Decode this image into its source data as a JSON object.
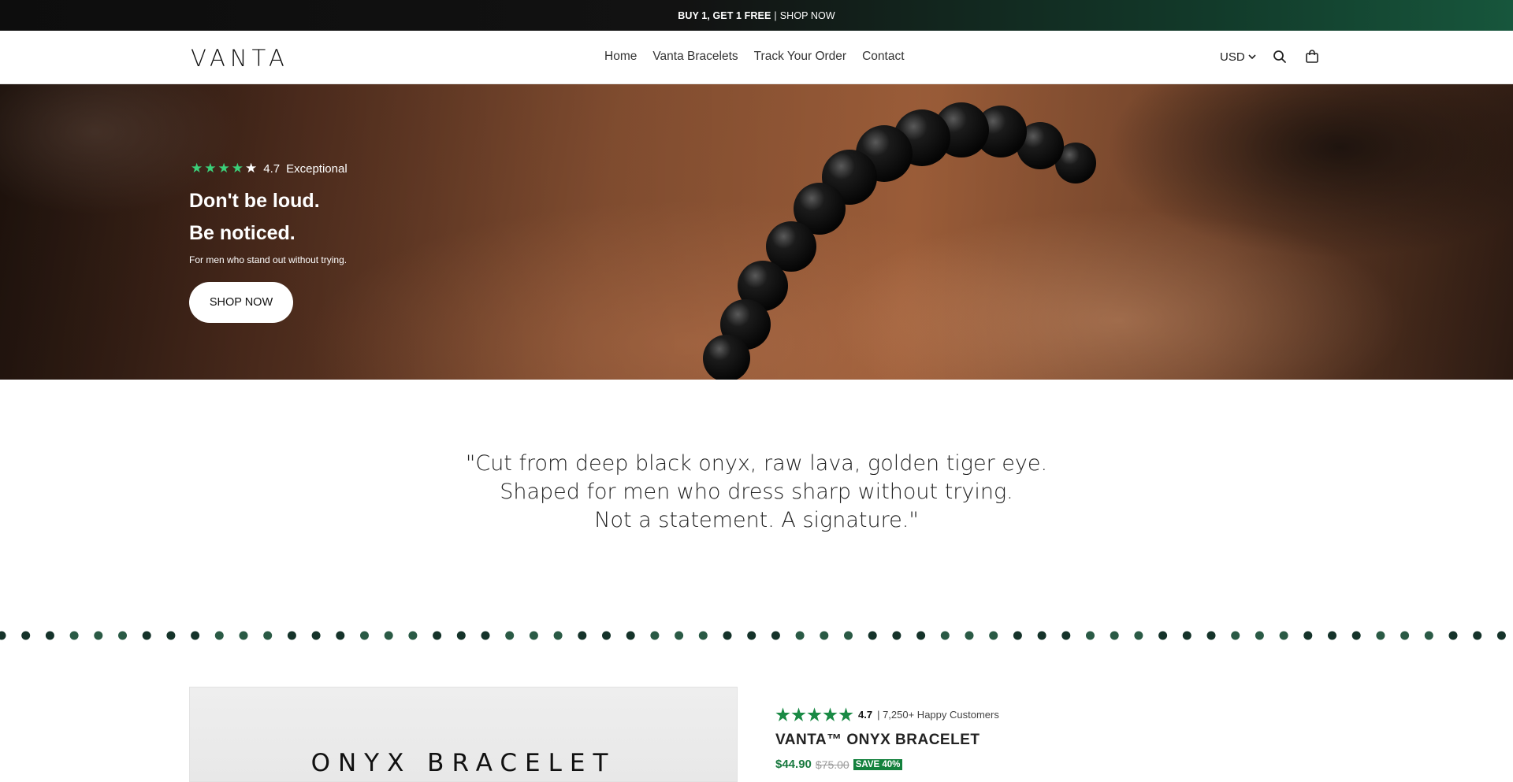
{
  "announcement": {
    "promo": "BUY 1, GET 1 FREE",
    "separator": "|",
    "link": "SHOP NOW"
  },
  "header": {
    "logo": "VANTA",
    "nav": [
      "Home",
      "Vanta Bracelets",
      "Track Your Order",
      "Contact"
    ],
    "currency": "USD",
    "icons": {
      "currency_caret": "chevron-down-icon",
      "search": "search-icon",
      "cart": "shopping-bag-icon"
    }
  },
  "hero": {
    "rating_value": "4.7",
    "rating_label": "Exceptional",
    "rating_stars": 4.7,
    "headline_line1": "Don't be loud.",
    "headline_line2": "Be noticed.",
    "subtext": "For men who stand out without trying.",
    "cta": "SHOP NOW"
  },
  "quote": {
    "line1": "\"Cut from deep black onyx, raw lava, golden tiger eye.",
    "line2": "Shaped for men who dress sharp without trying.",
    "line3": "Not a statement. A signature.\""
  },
  "product": {
    "image_title": "ONYX BRACELET",
    "rating_value": "4.7",
    "rating_stars": 5,
    "customers": "| 7,250+ Happy Customers",
    "name": "VANTA™ ONYX BRACELET",
    "price": "$44.90",
    "compare_price": "$75.00",
    "save_badge": "SAVE 40%"
  },
  "colors": {
    "accent_green": "#1a8a45",
    "hero_star_green": "#3bcf79",
    "dot_green": "#2a5a45",
    "dot_dark": "#15332a"
  }
}
